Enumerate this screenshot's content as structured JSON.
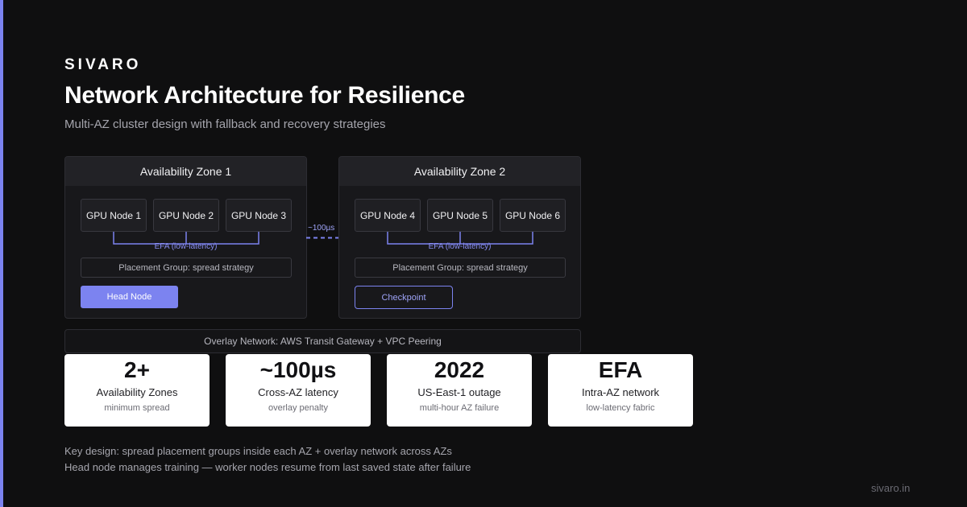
{
  "brand": "SIVARO",
  "title": "Network Architecture for Resilience",
  "subtitle": "Multi-AZ cluster design with fallback and recovery strategies",
  "zones": [
    {
      "name": "Availability Zone 1",
      "nodes": [
        "GPU Node 1",
        "GPU Node 2",
        "GPU Node 3"
      ],
      "efa_label": "EFA (low-latency)",
      "placement": "Placement Group: spread strategy",
      "action": "Head Node"
    },
    {
      "name": "Availability Zone 2",
      "nodes": [
        "GPU Node 4",
        "GPU Node 5",
        "GPU Node 6"
      ],
      "efa_label": "EFA (low-latency)",
      "placement": "Placement Group: spread strategy",
      "action": "Checkpoint"
    }
  ],
  "cross_az_link": "~100µs",
  "overlay": "Overlay Network: AWS Transit Gateway + VPC Peering",
  "stats": [
    {
      "value": "2+",
      "label": "Availability Zones",
      "note": "minimum spread"
    },
    {
      "value": "~100µs",
      "label": "Cross-AZ latency",
      "note": "overlay penalty"
    },
    {
      "value": "2022",
      "label": "US-East-1 outage",
      "note": "multi-hour AZ failure"
    },
    {
      "value": "EFA",
      "label": "Intra-AZ network",
      "note": "low-latency fabric"
    }
  ],
  "notes": [
    "Key design: spread placement groups inside each AZ + overlay network across AZs",
    "Head node manages training — worker nodes resume from last saved state after failure"
  ],
  "footer": "sivaro.in",
  "colors": {
    "accent": "#7c83f0",
    "background": "#0f0f10",
    "card": "#ffffff"
  }
}
